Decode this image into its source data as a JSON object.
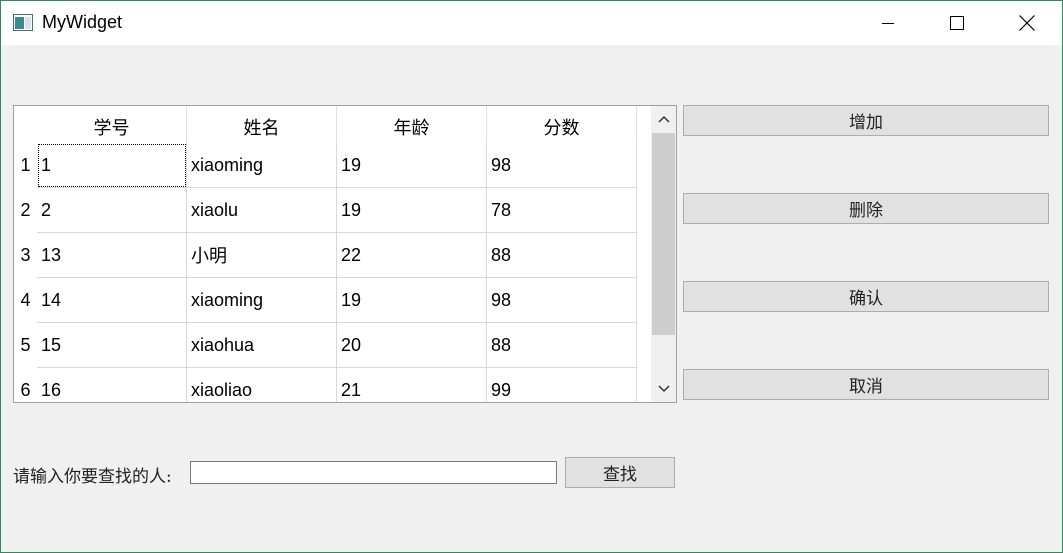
{
  "window": {
    "title": "MyWidget"
  },
  "table": {
    "headers": [
      "学号",
      "姓名",
      "年龄",
      "分数"
    ],
    "row_numbers": [
      "1",
      "2",
      "3",
      "4",
      "5",
      "6"
    ],
    "rows": [
      [
        "1",
        "xiaoming",
        "19",
        "98"
      ],
      [
        "2",
        "xiaolu",
        "19",
        "78"
      ],
      [
        "13",
        "小明",
        "22",
        "88"
      ],
      [
        "14",
        "xiaoming",
        "19",
        "98"
      ],
      [
        "15",
        "xiaohua",
        "20",
        "88"
      ],
      [
        "16",
        "xiaoliao",
        "21",
        "99"
      ]
    ]
  },
  "buttons": {
    "add": "增加",
    "delete": "删除",
    "confirm": "确认",
    "cancel": "取消",
    "search": "查找"
  },
  "search": {
    "label": "请输入你要查找的人:",
    "value": "",
    "placeholder": ""
  },
  "colors": {
    "window_border": "#2f8a5a",
    "button_bg": "#e1e1e1",
    "scroll_thumb": "#cdcdcd"
  }
}
